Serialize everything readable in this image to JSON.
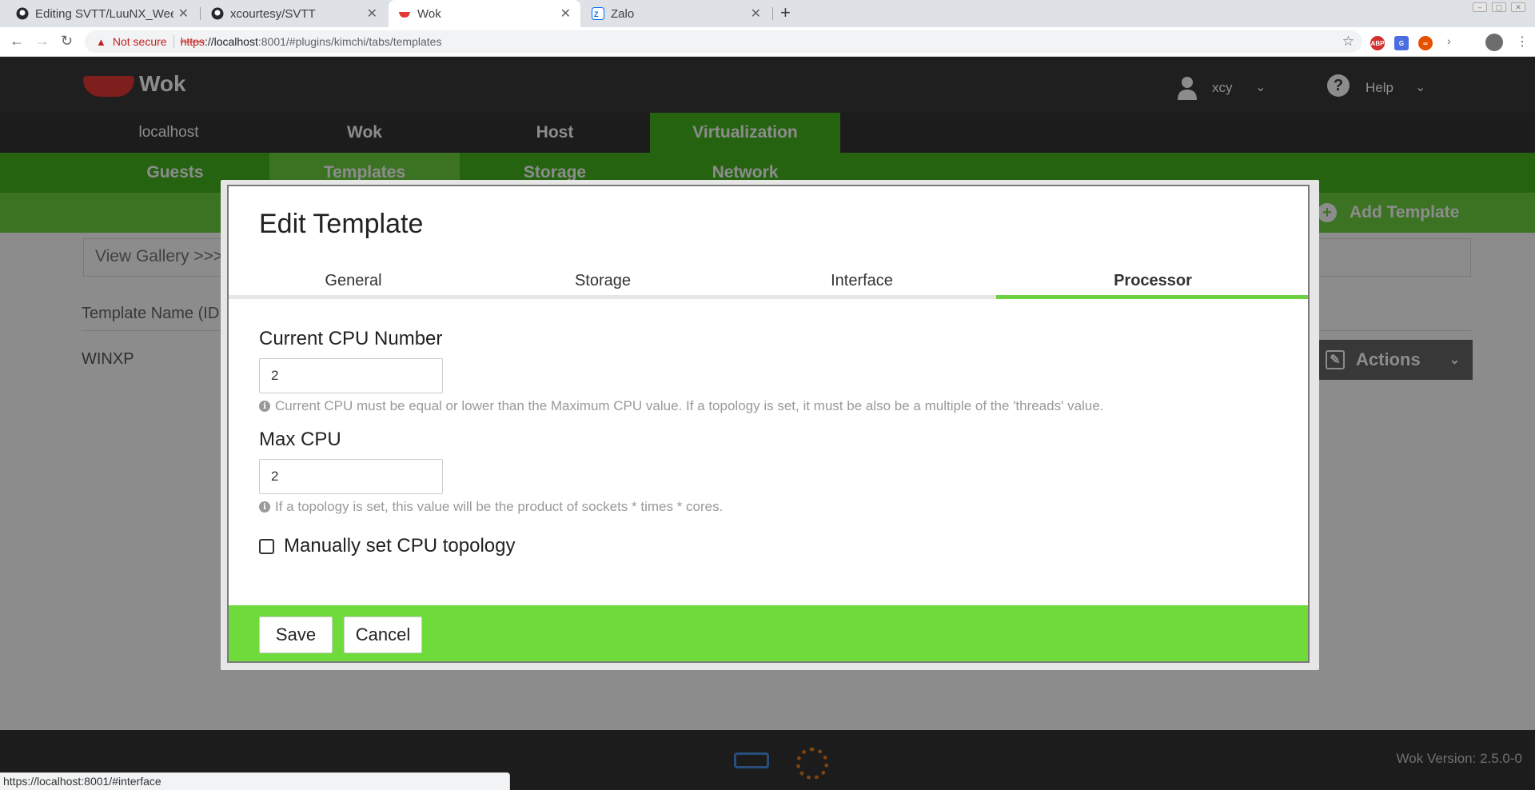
{
  "browser": {
    "tabs": [
      {
        "title": "Editing SVTT/LuuNX_Wee",
        "icon": "github-icon",
        "active": false
      },
      {
        "title": "xcourtesy/SVTT",
        "icon": "github-icon",
        "active": false
      },
      {
        "title": "Wok",
        "icon": "wok-icon",
        "active": true
      },
      {
        "title": "Zalo",
        "icon": "zalo-icon",
        "active": false
      }
    ],
    "security_label": "Not secure",
    "url_scheme": "https",
    "url_host": "://localhost",
    "url_rest": ":8001/#plugins/kimchi/tabs/templates",
    "status_url": "https://localhost:8001/#interface",
    "extensions": [
      {
        "name": "adblock-extension-icon",
        "label": "ABP",
        "color": "#d32f2f"
      },
      {
        "name": "translate-extension-icon",
        "label": "G",
        "color": "#4a6ee0"
      },
      {
        "name": "infinity-extension-icon",
        "label": "∞",
        "color": "#e65100"
      }
    ]
  },
  "header": {
    "brand": "Wok",
    "user": "xcy",
    "help": "Help"
  },
  "topnav": {
    "items": [
      "localhost",
      "Wok",
      "Host",
      "Virtualization"
    ],
    "active": "Virtualization"
  },
  "subnav": {
    "items": [
      "Guests",
      "Templates",
      "Storage",
      "Network"
    ],
    "active": "Templates"
  },
  "actionbar": {
    "add_template": "Add Template"
  },
  "content": {
    "view_gallery": "View Gallery >>>",
    "column_header": "Template Name (ID",
    "rows": [
      "WINXP"
    ],
    "actions_label": "Actions"
  },
  "modal": {
    "title": "Edit Template",
    "tabs": [
      "General",
      "Storage",
      "Interface",
      "Processor"
    ],
    "active_tab": "Processor",
    "current_cpu_label": "Current CPU Number",
    "current_cpu_value": "2",
    "current_cpu_hint": "Current CPU must be equal or lower than the Maximum CPU value. If a topology is set, it must be also be a multiple of the 'threads' value.",
    "max_cpu_label": "Max CPU",
    "max_cpu_value": "2",
    "max_cpu_hint": "If a topology is set, this value will be the product of sockets * times * cores.",
    "topology_label": "Manually set CPU topology",
    "topology_checked": false,
    "save_label": "Save",
    "cancel_label": "Cancel"
  },
  "footer": {
    "version": "Wok Version: 2.5.0-0"
  },
  "colors": {
    "accent_green": "#6ed141",
    "nav_green": "#45b51f",
    "modal_footer_green": "#6edb3a"
  }
}
